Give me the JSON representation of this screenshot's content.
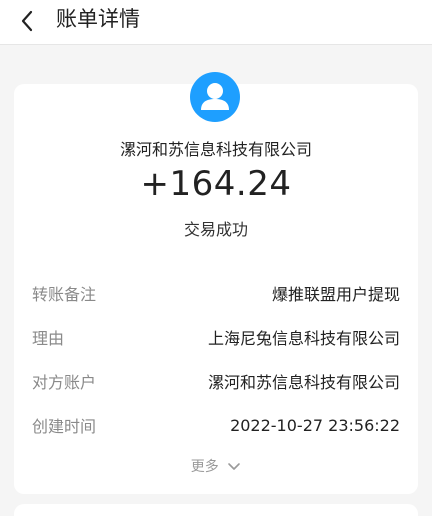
{
  "header": {
    "title": "账单详情"
  },
  "summary": {
    "payee_name": "漯河和苏信息科技有限公司",
    "amount": "+164.24",
    "status": "交易成功"
  },
  "details": [
    {
      "key": "转账备注",
      "value": "爆推联盟用户提现"
    },
    {
      "key": "理由",
      "value": "上海尼兔信息科技有限公司"
    },
    {
      "key": "对方账户",
      "value": "漯河和苏信息科技有限公司"
    },
    {
      "key": "创建时间",
      "value": "2022-10-27 23:56:22"
    }
  ],
  "more_label": "更多",
  "icons": {
    "back": "chevron-left-icon",
    "avatar": "user-avatar-icon",
    "more": "chevron-down-icon"
  },
  "colors": {
    "avatar_bg": "#1e9fff",
    "background": "#f5f5f5",
    "muted_text": "#8a8a8a"
  }
}
